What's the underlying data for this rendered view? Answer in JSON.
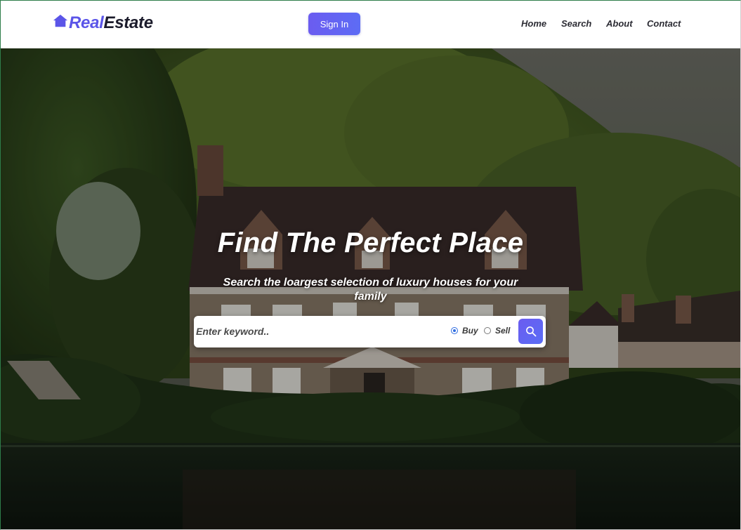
{
  "header": {
    "logo": {
      "part1": "Real",
      "part2": "Estate",
      "icon": "house-icon"
    },
    "signin_label": "Sign In",
    "nav": [
      {
        "label": "Home"
      },
      {
        "label": "Search"
      },
      {
        "label": "About"
      },
      {
        "label": "Contact"
      }
    ]
  },
  "hero": {
    "title": "Find The Perfect Place",
    "subtitle": "Search the loargest selection of luxury houses for your family",
    "search": {
      "placeholder": "Enter keyword..",
      "value": "",
      "options": [
        {
          "label": "Buy",
          "checked": true
        },
        {
          "label": "Sell",
          "checked": false
        }
      ],
      "button_icon": "search-icon"
    }
  },
  "colors": {
    "accent": "#5b55e8",
    "accent_button": "#6661ef",
    "logo_dark": "#1b1b2b"
  }
}
